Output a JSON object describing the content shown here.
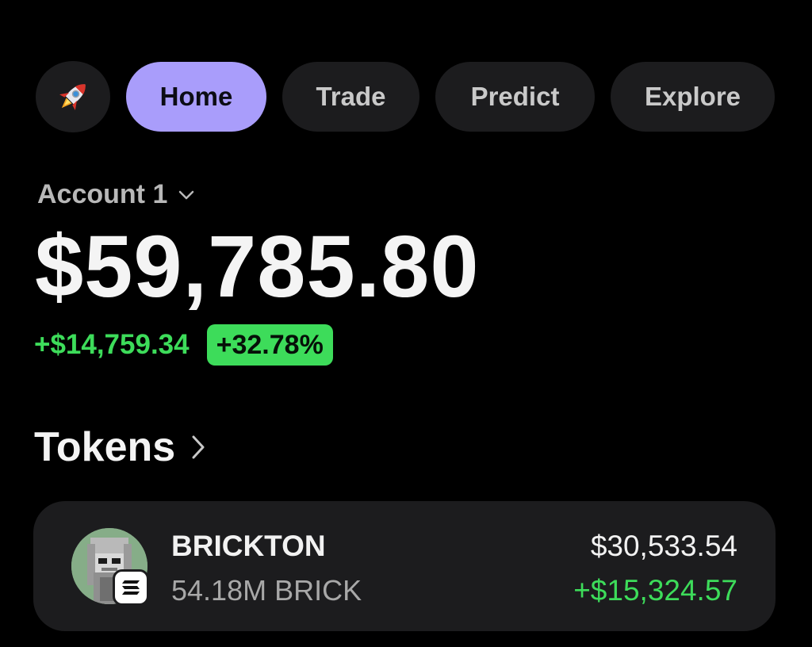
{
  "nav": {
    "logo_icon": "rocket-icon",
    "tabs": [
      {
        "label": "Home",
        "active": true
      },
      {
        "label": "Trade",
        "active": false
      },
      {
        "label": "Predict",
        "active": false
      },
      {
        "label": "Explore",
        "active": false
      }
    ]
  },
  "account": {
    "name": "Account 1",
    "chevron_icon": "chevron-down-icon",
    "balance": "$59,785.80",
    "change_amount": "+$14,759.34",
    "change_percent": "+32.78%"
  },
  "tokens": {
    "title": "Tokens",
    "chevron_icon": "chevron-right-icon",
    "items": [
      {
        "name": "BRICKTON",
        "amount": "54.18M BRICK",
        "value": "$30,533.54",
        "change": "+$15,324.57",
        "avatar_icon": "token-avatar",
        "chain_icon": "solana-icon"
      }
    ]
  },
  "colors": {
    "background": "#000000",
    "surface": "#1c1c1e",
    "accent": "#a99dfb",
    "positive": "#3ddc5a",
    "text_primary": "#f4f4f4",
    "text_secondary": "#a8a8a8"
  }
}
